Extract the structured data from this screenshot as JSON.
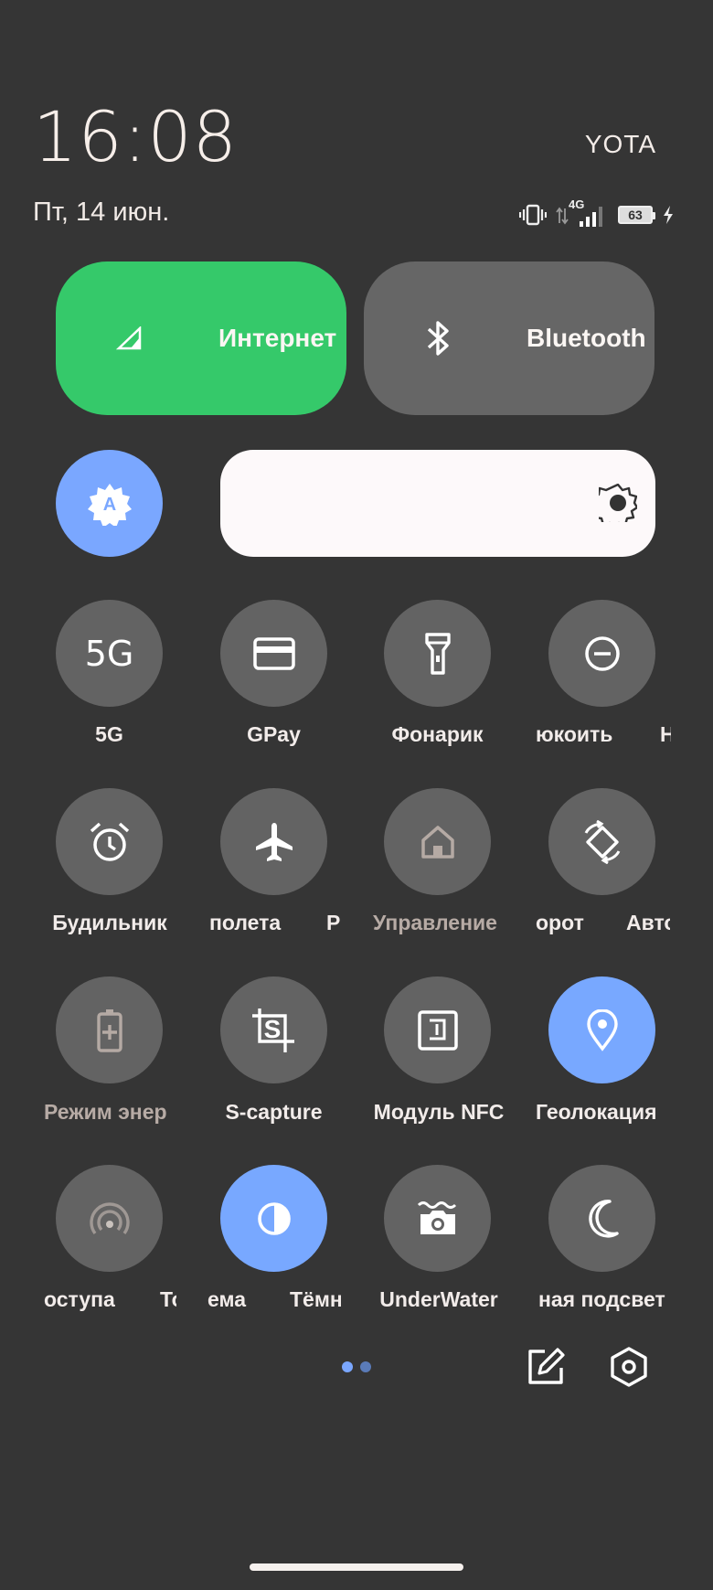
{
  "status": {
    "time": "16:08",
    "carrier": "YOTA",
    "date": "Пт, 14 июн.",
    "network_type": "4G",
    "battery_level": "63"
  },
  "big_tiles": [
    {
      "label": "Интернет",
      "icon": "cellular-signal-icon",
      "active": true,
      "color": "#35c96a"
    },
    {
      "label": "Bluetooth",
      "icon": "bluetooth-icon",
      "active": false,
      "color": "#666666"
    }
  ],
  "brightness": {
    "auto_icon": "auto-brightness-icon",
    "slider_icon": "brightness-sun-icon"
  },
  "rows": [
    [
      {
        "label": "5G",
        "icon_text": "5G",
        "icon": "5g-text-icon"
      },
      {
        "label": "GPay",
        "icon": "card-icon"
      },
      {
        "label": "Фонарик",
        "icon": "flashlight-icon"
      },
      {
        "label": "юкоить",
        "icon": "do-not-disturb-icon"
      },
      {
        "label": "Н",
        "icon": ""
      }
    ],
    [
      {
        "label": "Будильник",
        "icon": "alarm-icon"
      },
      {
        "label": "полета",
        "icon": "airplane-icon"
      },
      {
        "label": "Р",
        "icon": ""
      },
      {
        "label": "Управление",
        "icon": "home-icon",
        "dim": true
      },
      {
        "label": "орот",
        "icon": "auto-rotate-icon"
      },
      {
        "label": "Авто",
        "icon": ""
      }
    ],
    [
      {
        "label": "Режим энер",
        "icon": "battery-saver-icon",
        "dim": true
      },
      {
        "label": "S-capture",
        "icon": "screenshot-icon"
      },
      {
        "label": "Модуль NFC",
        "icon": "nfc-icon"
      },
      {
        "label": "Геолокация",
        "icon": "location-pin-icon",
        "active": true
      }
    ],
    [
      {
        "label": "оступа",
        "icon": "hotspot-icon"
      },
      {
        "label": "То",
        "icon": ""
      },
      {
        "label": "ема",
        "icon": "dark-theme-icon",
        "active": true
      },
      {
        "label": "Тёмн",
        "icon": ""
      },
      {
        "label": "UnderWater",
        "icon": "underwater-camera-icon"
      },
      {
        "label": "ная подсвет",
        "icon": "night-light-moon-icon"
      }
    ]
  ],
  "page_indicator": {
    "count": 2,
    "current": 0
  },
  "colors": {
    "background": "#353535",
    "tile_inactive": "#636363",
    "tile_active": "#78a8ff",
    "internet_green": "#35c96a"
  }
}
